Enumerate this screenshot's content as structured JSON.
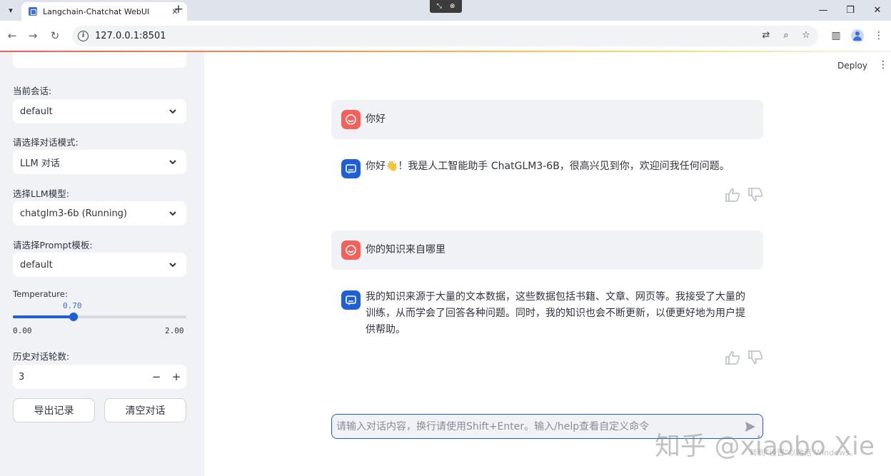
{
  "browser": {
    "tab_title": "Langchain-Chatchat WebUI",
    "url": "127.0.0.1:8501"
  },
  "sidebar": {
    "conversation_label": "当前会话:",
    "conversation_value": "default",
    "mode_label": "请选择对话模式:",
    "mode_value": "LLM 对话",
    "llm_label": "选择LLM模型:",
    "llm_value": "chatglm3-6b (Running)",
    "prompt_label": "请选择Prompt模板:",
    "prompt_value": "default",
    "temperature_label": "Temperature:",
    "temperature_value": "0.70",
    "temperature": 0.7,
    "temperature_min": "0.00",
    "temperature_max": "2.00",
    "temperature_max_num": 2.0,
    "history_label": "历史对话轮数:",
    "history_value": "3",
    "export_button": "导出记录",
    "clear_button": "清空对话"
  },
  "header": {
    "deploy": "Deploy"
  },
  "chat": {
    "messages": [
      {
        "role": "user",
        "text": "你好"
      },
      {
        "role": "assistant",
        "text": "你好👋！我是人工智能助手 ChatGLM3-6B，很高兴见到你，欢迎问我任何问题。"
      },
      {
        "role": "user",
        "text": "你的知识来自哪里"
      },
      {
        "role": "assistant",
        "text": "我的知识来源于大量的文本数据，这些数据包括书籍、文章、网页等。我接受了大量的训练，从而学会了回答各种问题。同时，我的知识也会不断更新，以便更好地为用户提供帮助。"
      }
    ],
    "input_placeholder": "请输入对话内容，换行请使用Shift+Enter。输入/help查看自定义命令"
  },
  "watermark": {
    "text": "知乎 @xiaobo Xie",
    "windows_notice": "转到\"设置\"以激活 Windows。"
  },
  "colors": {
    "accent": "#1f5fd6",
    "user_avatar": "#f4615b",
    "sidebar_bg": "#f0f2f6"
  }
}
